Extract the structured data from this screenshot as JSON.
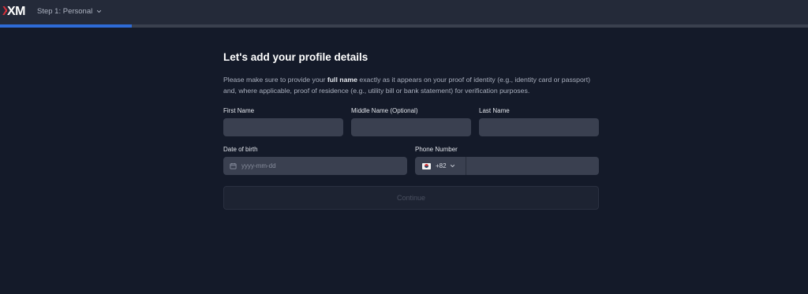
{
  "header": {
    "logo_text": "XM",
    "step_label": "Step 1: Personal",
    "progress_fraction": 0.163,
    "accent_color": "#2e6bd6",
    "logo_accent_color": "#d62f3a"
  },
  "form": {
    "title": "Let's add your profile details",
    "description_before": "Please make sure to provide your ",
    "description_bold": "full name",
    "description_after": " exactly as it appears on your proof of identity (e.g., identity card or passport) and, where applicable, proof of residence (e.g., utility bill or bank statement) for verification purposes.",
    "first_name": {
      "label": "First Name",
      "value": ""
    },
    "middle_name": {
      "label": "Middle Name (Optional)",
      "value": ""
    },
    "last_name": {
      "label": "Last Name",
      "value": ""
    },
    "date_of_birth": {
      "label": "Date of birth",
      "placeholder": "yyyy-mm-dd",
      "icon": "calendar-icon"
    },
    "phone": {
      "label": "Phone Number",
      "country_code": "+82",
      "flag": "kr-flag-icon",
      "value": ""
    },
    "continue_label": "Continue"
  }
}
